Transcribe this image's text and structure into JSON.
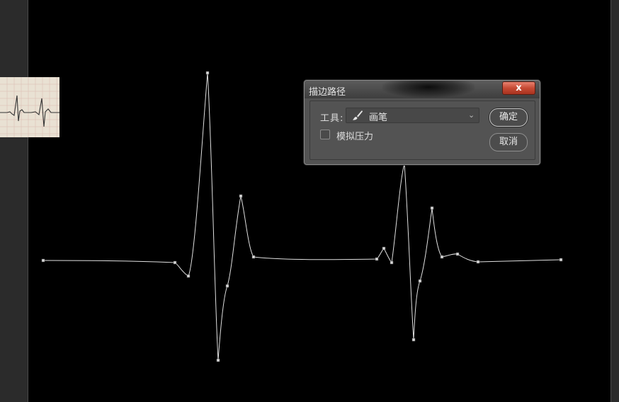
{
  "dialog": {
    "title": "描边路径",
    "close_glyph": "x",
    "tool_label": "工具:",
    "tool_value": "画笔",
    "simulate_pressure_label": "模拟压力",
    "simulate_pressure_checked": false,
    "ok_label": "确定",
    "cancel_label": "取消"
  },
  "icons": {
    "brush": "brush-icon",
    "dropdown": "chevron-down-icon",
    "close": "close-icon"
  },
  "colors": {
    "canvas": "#000000",
    "path_stroke": "#e0e0e0",
    "anchor_point": "#d8d8d8",
    "dialog_bg": "#535353",
    "close_button": "#c64a34"
  }
}
